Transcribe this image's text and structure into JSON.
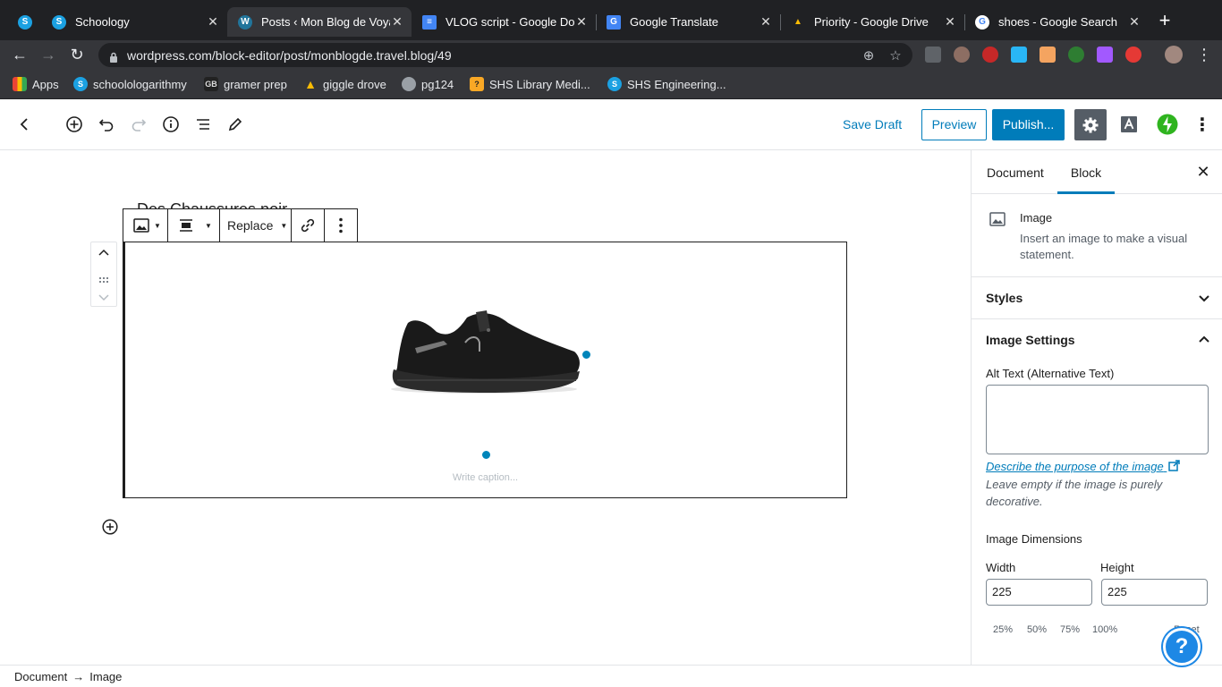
{
  "browser": {
    "tabs": [
      {
        "title": "Schoology",
        "favicon_letter": "S",
        "favicon_color": "#1ba1e2",
        "active": false
      },
      {
        "title": "Posts ‹ Mon Blog de Voyage",
        "favicon_letter": "W",
        "favicon_color": "#21759b",
        "active": true
      },
      {
        "title": "VLOG script - Google Docs",
        "favicon_letter": "≡",
        "favicon_color": "#4285f4",
        "active": false
      },
      {
        "title": "Google Translate",
        "favicon_letter": "G",
        "favicon_color": "#4285f4",
        "active": false
      },
      {
        "title": "Priority - Google Drive",
        "favicon_letter": "▲",
        "favicon_color": "#fbbc04",
        "active": false
      },
      {
        "title": "shoes - Google Search",
        "favicon_letter": "G",
        "favicon_color": "#ffffff",
        "active": false
      }
    ],
    "new_tab": "+",
    "url": "wordpress.com/block-editor/post/monblogde.travel.blog/49",
    "bookmarks": [
      {
        "label": "Apps",
        "icon": "apps-grid-icon",
        "color": "#ea4335"
      },
      {
        "label": "schoolologarithmy",
        "icon": "schoology-icon",
        "color": "#1ba1e2"
      },
      {
        "label": "gramer prep",
        "icon": "gb-icon",
        "color": "#222222"
      },
      {
        "label": "giggle drove",
        "icon": "drive-icon",
        "color": "#fbbc04"
      },
      {
        "label": "pg124",
        "icon": "globe-icon",
        "color": "#9aa0a6"
      },
      {
        "label": "SHS Library Medi...",
        "icon": "library-icon",
        "color": "#f9a825"
      },
      {
        "label": "SHS Engineering...",
        "icon": "schoology-icon",
        "color": "#1ba1e2"
      }
    ]
  },
  "editor": {
    "save_draft": "Save Draft",
    "preview": "Preview",
    "publish": "Publish...",
    "accent": "#007cba",
    "post_heading": "Des Chaussures noir",
    "toolbar": {
      "replace": "Replace"
    },
    "caption_placeholder": "Write caption...",
    "breadcrumb": [
      "Document",
      "Image"
    ],
    "breadcrumb_sep": "→"
  },
  "sidebar": {
    "tabs": [
      "Document",
      "Block"
    ],
    "active_tab": "Block",
    "block_name": "Image",
    "block_description": "Insert an image to make a visual statement.",
    "styles_panel": "Styles",
    "image_settings_panel": "Image Settings",
    "alt_text_label": "Alt Text (Alternative Text)",
    "alt_text_value": "",
    "describe_link": "Describe the purpose of the image",
    "describe_help": "Leave empty if the image is purely decorative.",
    "dimensions_label": "Image Dimensions",
    "width_label": "Width",
    "height_label": "Height",
    "width_value": "225",
    "height_value": "225",
    "percent_presets": [
      "25%",
      "50%",
      "75%",
      "100%"
    ],
    "reset": "Reset"
  },
  "help_fab": "?"
}
